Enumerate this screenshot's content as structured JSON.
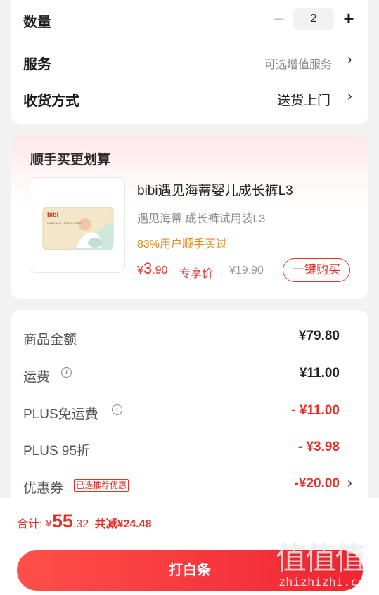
{
  "top_card": {
    "quantity_label": "数量",
    "quantity_minus": "−",
    "quantity_value": "2",
    "quantity_plus": "+",
    "service_label": "服务",
    "service_value": "可选增值服务",
    "delivery_label": "收货方式",
    "delivery_value": "送货上门",
    "chevron": "›"
  },
  "upsell": {
    "title": "顺手买更划算",
    "product_name": "bibi遇见海蒂婴儿成长裤L3",
    "product_subtitle": "遇见海蒂 成长裤试用装L3",
    "social_proof": "83%用户顺手买过",
    "price_symbol": "¥",
    "price_int": "3",
    "price_dec": ".90",
    "price_tag": "专享价",
    "original_price": "¥19.90",
    "buy_button": "一键购买",
    "thumb_brand": "bibi",
    "thumb_text": "HAND AND MOUTH WIPES"
  },
  "summary": {
    "rows": [
      {
        "label": "商品金额",
        "value": "¥79.80"
      },
      {
        "label": "运费",
        "value": "¥11.00"
      },
      {
        "label": "PLUS免运费",
        "value": "- ¥11.00"
      },
      {
        "label": "PLUS 95折",
        "value": "- ¥3.98"
      },
      {
        "label": "优惠券",
        "value": "-¥20.00",
        "tag": "已选推荐优惠"
      }
    ],
    "info_glyph": "i"
  },
  "bottom": {
    "total_label": "合计:",
    "total_symbol": "¥",
    "total_int": "55",
    "total_dec": ".32",
    "saved_label": "共减¥24.48",
    "cta": "打白条",
    "watermark_logo": "值值值",
    "watermark_url": "zhizhizhi.com"
  },
  "colors": {
    "accent": "#e4322b",
    "orange": "#e08a1e",
    "cta_start": "#ff4f4a",
    "cta_end": "#ef2532"
  }
}
